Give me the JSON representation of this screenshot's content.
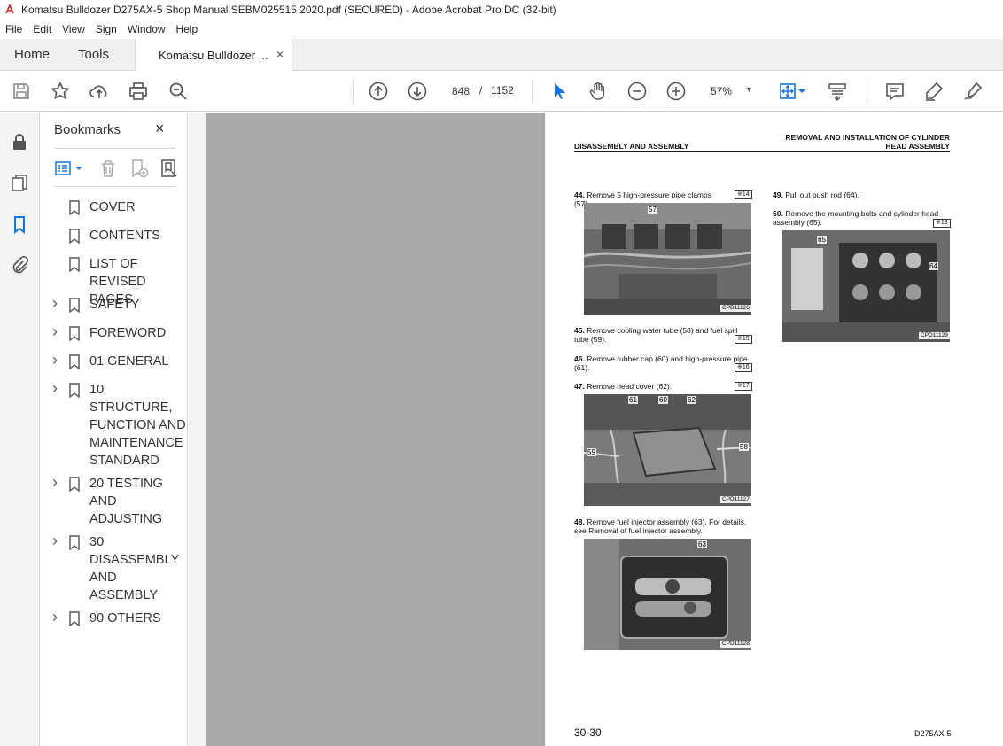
{
  "window": {
    "title": "Komatsu Bulldozer D275AX-5 Shop Manual SEBM025515 2020.pdf (SECURED) - Adobe Acrobat Pro DC (32-bit)"
  },
  "menu": [
    "File",
    "Edit",
    "View",
    "Sign",
    "Window",
    "Help"
  ],
  "tabs": {
    "home": "Home",
    "tools": "Tools",
    "document": "Komatsu Bulldozer ...",
    "close": "×"
  },
  "toolbar": {
    "current_page": "848",
    "page_separator": "/",
    "total_pages": "1152",
    "zoom": "57%"
  },
  "bookmarks": {
    "title": "Bookmarks",
    "close": "×",
    "items": [
      {
        "label": "COVER",
        "expandable": false
      },
      {
        "label": "CONTENTS",
        "expandable": false
      },
      {
        "label": "LIST OF REVISED PAGES",
        "expandable": false
      },
      {
        "label": "SAFETY",
        "expandable": true
      },
      {
        "label": "FOREWORD",
        "expandable": true
      },
      {
        "label": "01 GENERAL",
        "expandable": true
      },
      {
        "label": "10 STRUCTURE, FUNCTION AND MAINTENANCE STANDARD",
        "expandable": true
      },
      {
        "label": "20 TESTING AND ADJUSTING",
        "expandable": true
      },
      {
        "label": "30 DISASSEMBLY AND ASSEMBLY",
        "expandable": true
      },
      {
        "label": "90 OTHERS",
        "expandable": true
      }
    ]
  },
  "page": {
    "header_left": "DISASSEMBLY AND ASSEMBLY",
    "header_right_line1": "REMOVAL AND INSTALLATION OF CYLINDER",
    "header_right_line2": "HEAD ASSEMBLY",
    "steps": {
      "s44": {
        "num": "44.",
        "text": "Remove 5 high-pressure pipe clamps (57).",
        "ref": "※14"
      },
      "s45": {
        "num": "45.",
        "text": "Remove cooling water tube (58) and fuel spill tube (59).",
        "ref": "※15"
      },
      "s46": {
        "num": "46.",
        "text": "Remove rubber cap (60) and high-pressure pipe (61).",
        "ref": "※16"
      },
      "s47": {
        "num": "47.",
        "text": "Remove head cover (62).",
        "ref": "※17"
      },
      "s48": {
        "num": "48.",
        "text": "Remove fuel injector assembly (63). For details, see Removal of fuel injector assembly."
      },
      "s49": {
        "num": "49.",
        "text": "Pull out push rod (64)."
      },
      "s50": {
        "num": "50.",
        "text": "Remove the mounting bolts and cylinder head assembly (65).",
        "ref": "※18"
      }
    },
    "photos": {
      "p1": {
        "callouts": [
          "57"
        ],
        "code": "CPD11126"
      },
      "p2": {
        "callouts": [
          "61",
          "60",
          "62",
          "58",
          "59"
        ],
        "code": "CPD11127"
      },
      "p3": {
        "callouts": [
          "63"
        ],
        "code": "CPD11128"
      },
      "p4": {
        "callouts": [
          "65",
          "64"
        ],
        "code": "CPD11129"
      }
    },
    "footer_page": "30-30",
    "footer_model": "D275AX-5"
  }
}
